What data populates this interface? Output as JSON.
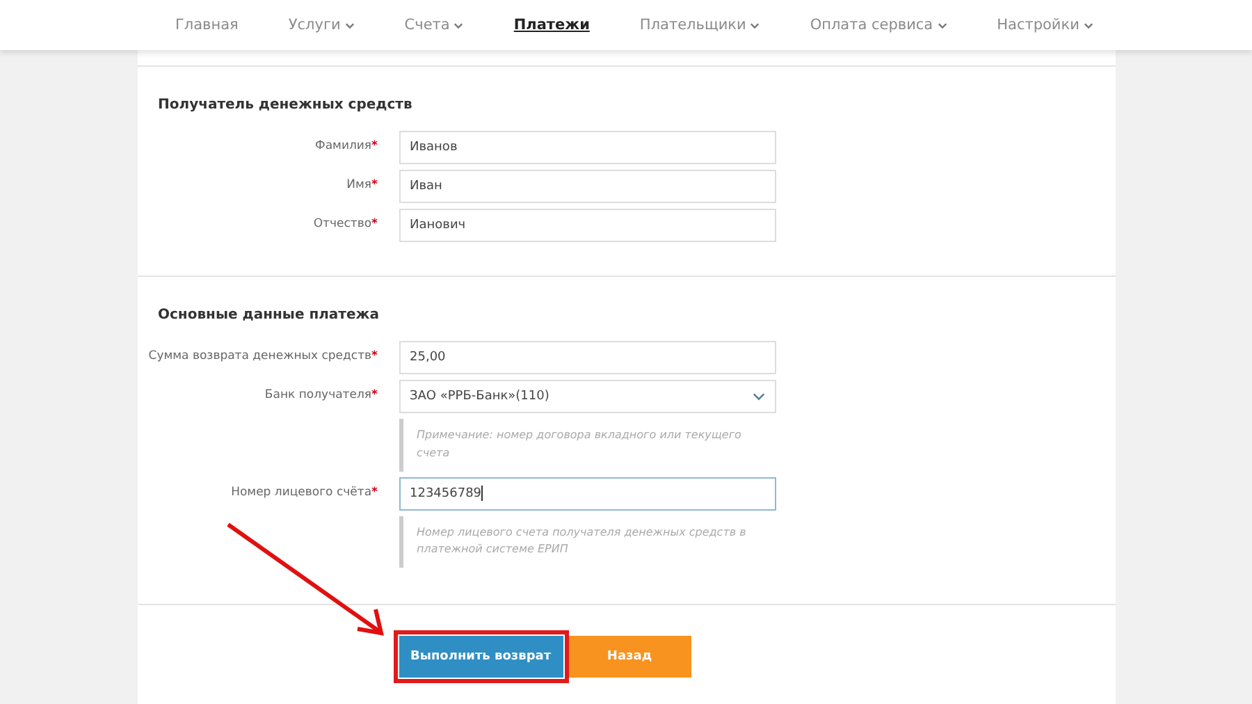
{
  "nav": [
    {
      "label": "Главная",
      "selected": false,
      "has_menu": false
    },
    {
      "label": "Услуги",
      "selected": false,
      "has_menu": true
    },
    {
      "label": "Счета",
      "selected": false,
      "has_menu": true
    },
    {
      "label": "Платежи",
      "selected": true,
      "has_menu": false
    },
    {
      "label": "Плательщики",
      "selected": false,
      "has_menu": true
    },
    {
      "label": "Оплата сервиса",
      "selected": false,
      "has_menu": true
    },
    {
      "label": "Настройки",
      "selected": false,
      "has_menu": true
    }
  ],
  "sections": [
    {
      "title": "Получатель денежных средств",
      "rows": [
        {
          "kind": "text",
          "label": "Фамилия",
          "required_mark": "*",
          "value": "Иванов",
          "focused": false
        },
        {
          "kind": "text",
          "label": "Имя",
          "required_mark": "*",
          "value": "Иван",
          "focused": false
        },
        {
          "kind": "text",
          "label": "Отчество",
          "required_mark": "*",
          "value": "Ианович",
          "focused": false
        }
      ]
    },
    {
      "title": "Основные данные платежа",
      "rows": [
        {
          "kind": "text",
          "label": "Сумма возврата денежных средств",
          "required_mark": "*",
          "value": "25,00",
          "focused": false
        },
        {
          "kind": "select",
          "label": "Банк получателя",
          "required_mark": "*",
          "value": "ЗАО «РРБ-Банк»(110)"
        },
        {
          "kind": "note",
          "text": "Примечание: номер договора вкладного или текущего счета"
        },
        {
          "kind": "text",
          "label": "Номер лицевого счёта",
          "required_mark": "*",
          "value": "123456789",
          "focused": true
        },
        {
          "kind": "note",
          "text": "Номер лицевого счета получателя денежных средств в платежной системе ЕРИП"
        }
      ]
    }
  ],
  "buttons": [
    {
      "label": "Выполнить возврат",
      "kind": "primary",
      "highlighted": true
    },
    {
      "label": "Назад",
      "kind": "secondary",
      "highlighted": false
    }
  ]
}
